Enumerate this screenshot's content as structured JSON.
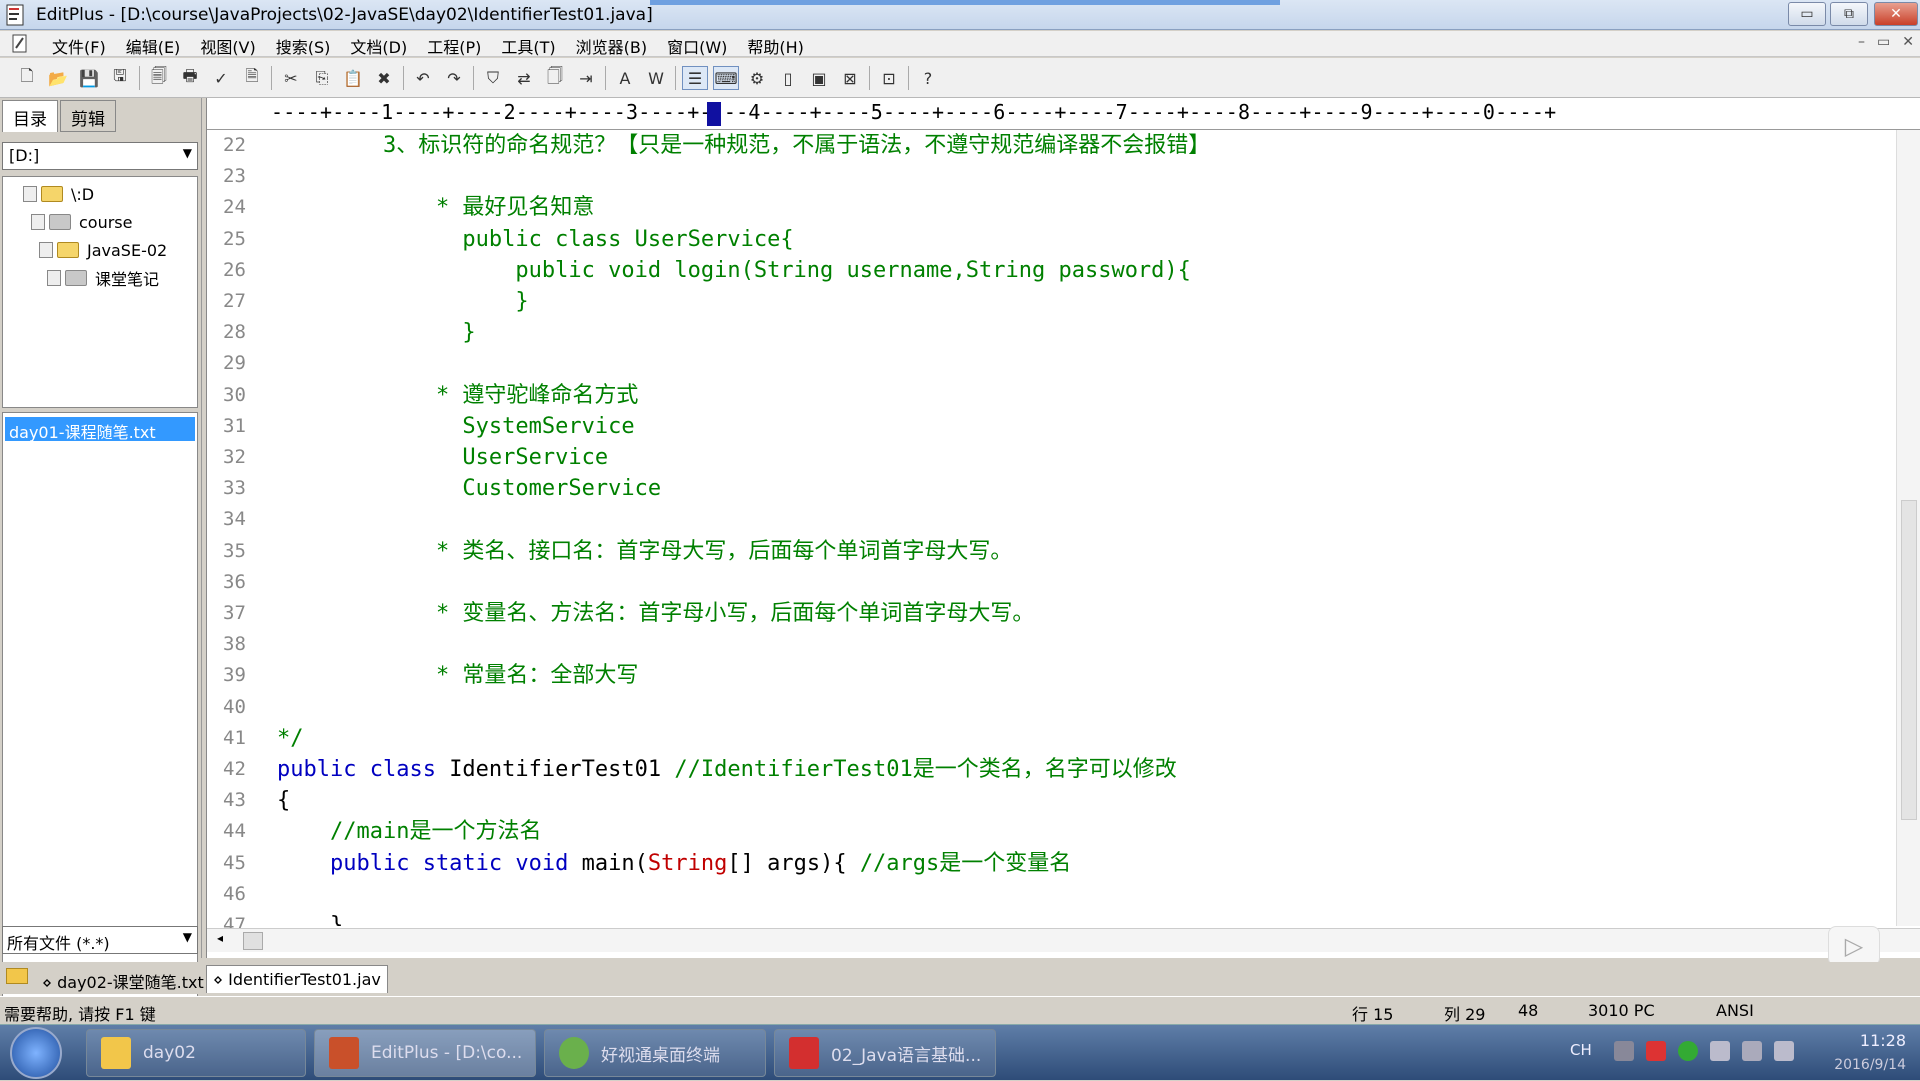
{
  "window": {
    "title": "EditPlus - [D:\\course\\JavaProjects\\02-JavaSE\\day02\\IdentifierTest01.java]",
    "controls": {
      "minimize": "▭",
      "restore": "⧉",
      "close": "✕"
    }
  },
  "menu": {
    "items": [
      "文件(F)",
      "编辑(E)",
      "视图(V)",
      "搜索(S)",
      "文档(D)",
      "工程(P)",
      "工具(T)",
      "浏览器(B)",
      "窗口(W)",
      "帮助(H)"
    ],
    "mdi": [
      "–",
      "▭",
      "✕"
    ]
  },
  "toolbar": {
    "icons": [
      "new-icon",
      "open-icon",
      "save-icon",
      "save-all-icon",
      "print-preview-icon",
      "print-icon",
      "spell-check-icon",
      "template-icon",
      "cut-icon",
      "copy-icon",
      "paste-icon",
      "delete-icon",
      "undo-icon",
      "redo-icon",
      "find-icon",
      "replace-icon",
      "find-in-files-icon",
      "goto-icon",
      "font-icon",
      "word-wrap-icon",
      "line-number-icon",
      "ruler-icon",
      "settings-icon",
      "split-icon",
      "fullscreen-icon",
      "browser-icon",
      "output-icon",
      "help-icon"
    ],
    "glyphs": [
      "🗋",
      "📂",
      "💾",
      "🖫",
      "🗐",
      "🖶",
      "✓",
      "🗎",
      "✂",
      "⎘",
      "📋",
      "✖",
      "↶",
      "↷",
      "⛉",
      "⇄",
      "🗍",
      "⇥",
      "A",
      "W",
      "☰",
      "⌨",
      "⚙",
      "▯",
      "▣",
      "⊠",
      "⊡",
      "?"
    ]
  },
  "sidebar": {
    "tabs": [
      "目录",
      "剪辑"
    ],
    "drive": "[D:]",
    "tree": [
      {
        "label": "\\:D",
        "type": "drive"
      },
      {
        "label": "course",
        "type": "folder"
      },
      {
        "label": "JavaSE-02",
        "type": "folder"
      },
      {
        "label": "课堂笔记",
        "type": "folder"
      }
    ],
    "files": [
      "day01-课程随笔.txt"
    ],
    "filter": "所有文件 (*.*)"
  },
  "editor": {
    "ruler": "----+----1----+----2----+----3----+----4----+----5----+----6----+----7----+----8----+----9----+----0----+",
    "lines": [
      {
        "n": "22",
        "parts": [
          {
            "t": "        3、标识符的命名规范？【只是一种规范，不属于语法，不遵守规范编译器不会报错】",
            "c": "cmt"
          }
        ]
      },
      {
        "n": "23",
        "parts": []
      },
      {
        "n": "24",
        "parts": [
          {
            "t": "            * 最好见名知意",
            "c": "cmt"
          }
        ]
      },
      {
        "n": "25",
        "parts": [
          {
            "t": "              public class UserService{",
            "c": "cmt"
          }
        ]
      },
      {
        "n": "26",
        "parts": [
          {
            "t": "                  public void login(String username,String password){",
            "c": "cmt"
          }
        ]
      },
      {
        "n": "27",
        "parts": [
          {
            "t": "                  }",
            "c": "cmt"
          }
        ]
      },
      {
        "n": "28",
        "parts": [
          {
            "t": "              }",
            "c": "cmt"
          }
        ]
      },
      {
        "n": "29",
        "parts": []
      },
      {
        "n": "30",
        "parts": [
          {
            "t": "            * 遵守驼峰命名方式",
            "c": "cmt"
          }
        ]
      },
      {
        "n": "31",
        "parts": [
          {
            "t": "              SystemService",
            "c": "cmt"
          }
        ]
      },
      {
        "n": "32",
        "parts": [
          {
            "t": "              UserService",
            "c": "cmt"
          }
        ]
      },
      {
        "n": "33",
        "parts": [
          {
            "t": "              CustomerService",
            "c": "cmt"
          }
        ]
      },
      {
        "n": "34",
        "parts": []
      },
      {
        "n": "35",
        "parts": [
          {
            "t": "            * 类名、接口名：首字母大写，后面每个单词首字母大写。",
            "c": "cmt"
          }
        ]
      },
      {
        "n": "36",
        "parts": []
      },
      {
        "n": "37",
        "parts": [
          {
            "t": "            * 变量名、方法名：首字母小写，后面每个单词首字母大写。",
            "c": "cmt"
          }
        ]
      },
      {
        "n": "38",
        "parts": []
      },
      {
        "n": "39",
        "parts": [
          {
            "t": "            * 常量名：全部大写",
            "c": "cmt"
          }
        ]
      },
      {
        "n": "40",
        "parts": []
      },
      {
        "n": "41",
        "parts": [
          {
            "t": "*/",
            "c": "cmt"
          }
        ]
      },
      {
        "n": "42",
        "parts": [
          {
            "t": "public class ",
            "c": "kw"
          },
          {
            "t": "IdentifierTest01 ",
            "c": "plain"
          },
          {
            "t": "//IdentifierTest01是一个类名，名字可以修改",
            "c": "cmt"
          }
        ]
      },
      {
        "n": "43",
        "parts": [
          {
            "t": "{",
            "c": "plain"
          }
        ]
      },
      {
        "n": "44",
        "parts": [
          {
            "t": "    //main是一个方法名",
            "c": "cmt"
          }
        ]
      },
      {
        "n": "45",
        "parts": [
          {
            "t": "    public static void ",
            "c": "kw"
          },
          {
            "t": "main(",
            "c": "plain"
          },
          {
            "t": "String",
            "c": "str"
          },
          {
            "t": "[] args){ ",
            "c": "plain"
          },
          {
            "t": "//args是一个变量名",
            "c": "cmt"
          }
        ]
      },
      {
        "n": "46",
        "parts": []
      },
      {
        "n": "47",
        "parts": [
          {
            "t": "    }",
            "c": "plain"
          }
        ]
      }
    ]
  },
  "filetabs": [
    "day02-课堂随笔.txt",
    "IdentifierTest01.jav"
  ],
  "status": {
    "help": "需要帮助, 请按 F1 键",
    "row": "行 15",
    "col": "列 29",
    "num": "48",
    "encoding_pc": "3010 PC",
    "charset": "ANSI"
  },
  "taskbar": {
    "items": [
      "day02",
      "EditPlus - [D:\\co...",
      "好视通桌面终端",
      "02_Java语言基础..."
    ],
    "tray": {
      "lang": "CH",
      "time": "11:28",
      "date": "2016/9/14"
    }
  },
  "colors": {
    "comment": "#008000",
    "keyword": "#0000c0",
    "string": "#c00000",
    "selection": "#3399ff"
  }
}
